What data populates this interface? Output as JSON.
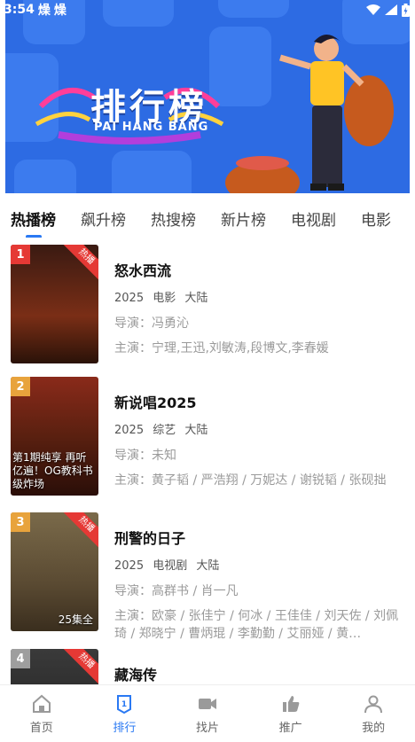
{
  "status_bar": {
    "time": "3:54",
    "notif1": "燥",
    "notif2": "燥"
  },
  "banner": {
    "title": "排行榜",
    "subtitle": "PAI HANG BANG"
  },
  "tabs": [
    "热播榜",
    "飙升榜",
    "热搜榜",
    "新片榜",
    "电视剧",
    "电影"
  ],
  "active_tab": "热播榜",
  "items": [
    {
      "rank": "1",
      "rank_color": "#e53935",
      "hot_label": "热播",
      "title": "怒水西流",
      "year": "2025",
      "genre": "电影",
      "region": "大陆",
      "director": "导演：冯勇沁",
      "cast": "主演：宁理,王迅,刘敏涛,段博文,李春媛",
      "poster_bg": "#5a2418",
      "poster_text": "",
      "poster_corner": ""
    },
    {
      "rank": "2",
      "rank_color": "#e8a33c",
      "hot_label": "",
      "title": "新说唱2025",
      "year": "2025",
      "genre": "综艺",
      "region": "大陆",
      "director": "导演：未知",
      "cast": "主演：黄子韬 / 严浩翔 / 万妮达 / 谢锐韬 / 张砚拙",
      "poster_bg": "#6b2a1a",
      "poster_text": "第1期纯享 再听亿遍！OG教科书级炸场",
      "poster_corner": ""
    },
    {
      "rank": "3",
      "rank_color": "#e8a33c",
      "hot_label": "热播",
      "title": "刑警的日子",
      "year": "2025",
      "genre": "电视剧",
      "region": "大陆",
      "director": "导演：高群书 / 肖一凡",
      "cast": "主演：欧豪 / 张佳宁 / 何冰 / 王佳佳 / 刘天佐 / 刘佩琦 / 郑晓宁 / 曹炳琨 / 李勤勤 / 艾丽娅 / 黄…",
      "poster_bg": "#6b5a3a",
      "poster_text": "",
      "poster_corner": "25集全"
    },
    {
      "rank": "4",
      "rank_color": "#9e9e9e",
      "hot_label": "热播",
      "title": "藏海传",
      "year": "",
      "genre": "",
      "region": "",
      "director": "",
      "cast": "",
      "poster_bg": "#2a2a2a",
      "poster_text": "",
      "poster_corner": ""
    }
  ],
  "bottom_nav": [
    {
      "label": "首页",
      "icon": "home-icon"
    },
    {
      "label": "排行",
      "icon": "ranking-icon"
    },
    {
      "label": "找片",
      "icon": "video-camera-icon"
    },
    {
      "label": "推广",
      "icon": "thumbs-up-icon"
    },
    {
      "label": "我的",
      "icon": "user-icon"
    }
  ],
  "colors": {
    "accent": "#2a79f3",
    "banner": "#2d6be3",
    "hot": "#e53935"
  }
}
